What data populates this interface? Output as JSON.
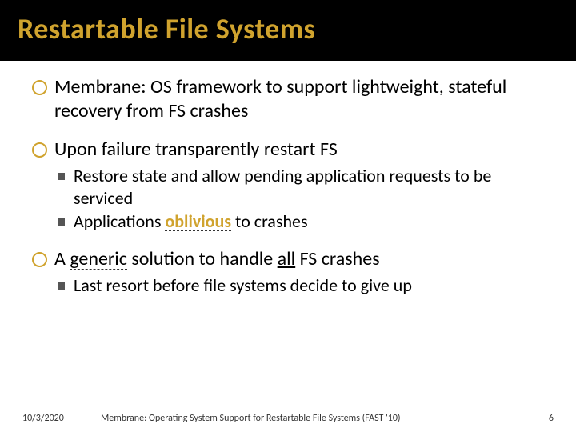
{
  "title": "Restartable File Systems",
  "bullets": {
    "b1": "Membrane: OS framework to support lightweight, stateful recovery from FS crashes",
    "b2": "Upon failure transparently restart FS",
    "b2_sub1": "Restore state and allow pending application requests to be serviced",
    "b2_sub2_pre": "Applications ",
    "b2_sub2_accent": "oblivious",
    "b2_sub2_post": " to crashes",
    "b3_pre": "A ",
    "b3_generic": "generic",
    "b3_mid": " solution to handle ",
    "b3_all": "all",
    "b3_post": " FS crashes",
    "b3_sub1": "Last resort before file systems decide to give up"
  },
  "footer": {
    "date": "10/3/2020",
    "title": "Membrane: Operating System Support for Restartable File Systems (FAST '10)",
    "page": "6"
  }
}
